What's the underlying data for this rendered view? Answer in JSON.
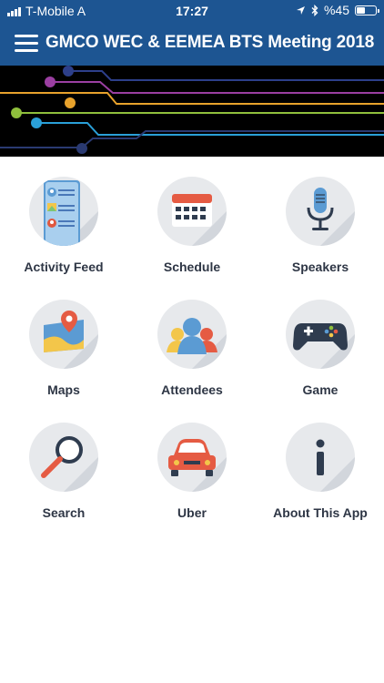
{
  "status_bar": {
    "carrier": "T-Mobile A",
    "time": "17:27",
    "battery_text": "%45",
    "battery_level": 0.45
  },
  "header": {
    "title": "GMCO WEC & EEMEA BTS Meeting 2018"
  },
  "colors": {
    "header": "#1d5592",
    "tile_bg": "#e7e9ec",
    "label": "#2e3645"
  },
  "menu": [
    {
      "label": "Activity Feed",
      "icon": "activity-feed-icon"
    },
    {
      "label": "Schedule",
      "icon": "calendar-icon"
    },
    {
      "label": "Speakers",
      "icon": "microphone-icon"
    },
    {
      "label": "Maps",
      "icon": "map-icon"
    },
    {
      "label": "Attendees",
      "icon": "people-icon"
    },
    {
      "label": "Game",
      "icon": "gamepad-icon"
    },
    {
      "label": "Search",
      "icon": "magnifier-icon"
    },
    {
      "label": "Uber",
      "icon": "car-icon"
    },
    {
      "label": "About This App",
      "icon": "info-icon"
    }
  ]
}
